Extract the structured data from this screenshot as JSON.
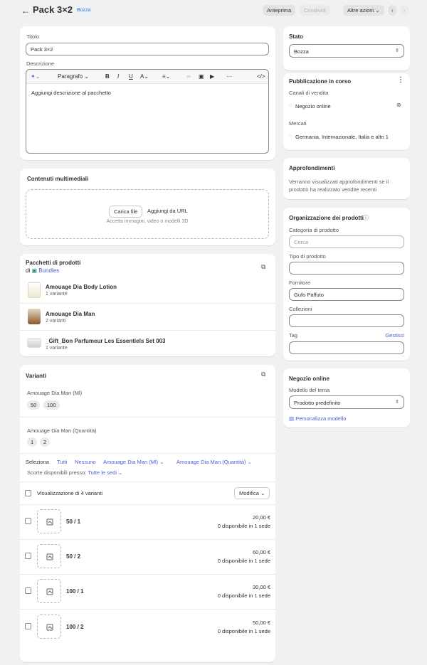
{
  "header": {
    "back_icon": "←",
    "title": "Pack 3×2",
    "badge": "Bozza",
    "buttons": {
      "preview": "Anteprima",
      "duplicate": "Condividi",
      "more_actions": "Altre azioni",
      "prev": "‹",
      "next": "›"
    }
  },
  "main": {
    "title_label": "Titolo",
    "title_value": "Pack 3×2",
    "description_label": "Descrizione",
    "editor": {
      "paragraph": "Paragrafo",
      "content": "Aggiungi descrizione al pacchetto"
    },
    "media": {
      "heading": "Contenuti multimediali",
      "upload": "Carica file",
      "add_url": "Aggiungi da URL",
      "hint": "Accetta immagini, video o modelli 3D"
    },
    "bundles": {
      "heading": "Pacchetti di prodotti",
      "app_prefix": "di",
      "app_name": "Bundles",
      "items": [
        {
          "name": "Amouage Dia Body Lotion",
          "sub": "1 variante"
        },
        {
          "name": "Amouage Dia Man",
          "sub": "2 varianti"
        },
        {
          "name": "_Gift_Bon Parfumeur Les Essentiels Set 003",
          "sub": "1 variante"
        }
      ]
    },
    "variants": {
      "heading": "Varianti",
      "option1_name": "Amouage Dia Man (Ml)",
      "option1_values": [
        "50",
        "100"
      ],
      "option2_name": "Amouage Dia Man (Quantità)",
      "option2_values": [
        "1",
        "2"
      ],
      "select_label": "Seleziona",
      "select_all": "Tutti",
      "select_none": "Nessuno",
      "filter1": "Amouage Dia Man (Ml)",
      "filter2": "Amouage Dia Man (Quantità)",
      "stock_label": "Scorte disponibili presso:",
      "stock_value": "Tutte le sedi",
      "showing": "Visualizzazione di 4 varianti",
      "edit": "Modifica",
      "rows": [
        {
          "name": "50 / 1",
          "price": "20,00 €",
          "avail": "0 disponibile in 1 sede"
        },
        {
          "name": "50 / 2",
          "price": "60,00 €",
          "avail": "0 disponibile in 1 sede"
        },
        {
          "name": "100 / 1",
          "price": "30,00 €",
          "avail": "0 disponibile in 1 sede"
        },
        {
          "name": "100 / 2",
          "price": "50,00 €",
          "avail": "0 disponibile in 1 sede"
        }
      ]
    }
  },
  "side": {
    "status": {
      "heading": "Stato",
      "value": "Bozza"
    },
    "publishing": {
      "heading": "Pubblicazione in corso",
      "channels_label": "Canali di vendita",
      "channel": "Negozio online",
      "markets_label": "Mercati",
      "markets": "Germania, Internazionale, Italia e altri 1"
    },
    "insights": {
      "heading": "Approfondimenti",
      "text_line1": "Verranno visualizzati approfondimenti se il",
      "text_line2": "prodotto ha realizzato vendite recenti"
    },
    "organization": {
      "heading": "Organizzazione dei prodotti",
      "category_label": "Categoria di prodotto",
      "category_placeholder": "Cerca",
      "type_label": "Tipo di prodotto",
      "vendor_label": "Fornitore",
      "vendor_value": "Gufo Paffuto",
      "collections_label": "Collezioni",
      "tags_label": "Tag",
      "tags_manage": "Gestisci"
    },
    "online_store": {
      "heading": "Negozio online",
      "template_label": "Modello del tema",
      "template_value": "Prodotto predefinito",
      "customize": "Personalizza modello"
    }
  }
}
